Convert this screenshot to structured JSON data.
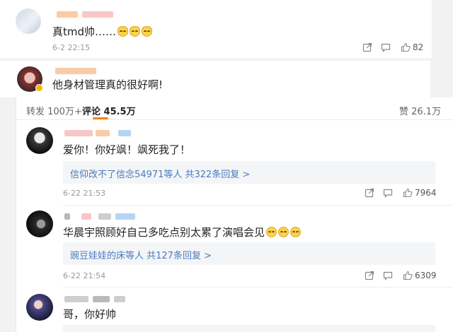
{
  "top_comment": {
    "text": "真tmd帅……",
    "time": "6-2 22:15",
    "likes": "82"
  },
  "mid_comment": {
    "text": "他身材管理真的很好啊!"
  },
  "tabs": {
    "repost": "转发 100万+",
    "comment": "评论 45.5万",
    "like": "赞 26.1万"
  },
  "comments": [
    {
      "text": "爱你！你好飒！飒死我了！",
      "reply": "信仰改不了信念54971等人  共322条回复 >",
      "time": "6-22 21:53",
      "likes": "7964"
    },
    {
      "text": "华晨宇照顾好自己多吃点别太累了演唱会见",
      "reply": "豌豆娃娃的床等人  共127条回复 >",
      "time": "6-22 21:54",
      "likes": "6309"
    },
    {
      "text": "哥，你好帅"
    }
  ],
  "colors": {
    "accent": "#ff8200",
    "link": "#4a7bbf",
    "background": "#f2f2f2"
  },
  "icons": [
    "share-icon",
    "comment-icon",
    "like-icon",
    "verified-badge-icon"
  ]
}
